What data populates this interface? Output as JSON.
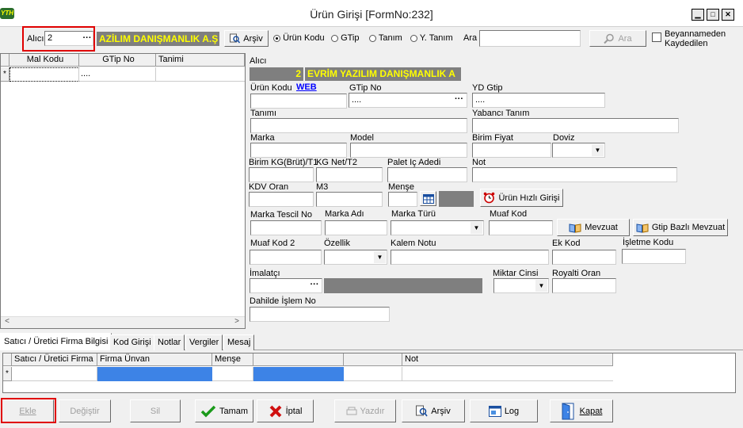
{
  "window": {
    "title": "Ürün Girişi [FormNo:232]",
    "app_icon_text": "YTH",
    "minimize": "▁",
    "maximize": "□",
    "close": "✕"
  },
  "toolbar": {
    "alici_label": "Alıcı",
    "alici_value": "2",
    "alici_lookup": "···",
    "alici_name": "AZİLIM DANIŞMANLIK A.Ş",
    "arsiv_label": "Arşiv",
    "radio_urun_kodu": "Ürün Kodu",
    "radio_gtip": "GTip",
    "radio_tanim": "Tanım",
    "radio_y_tanim": "Y. Tanım",
    "ara_label": "Ara",
    "ara_value": "",
    "ara_button": "Ara",
    "beyanname_line1": "Beyannameden",
    "beyanname_line2": "Kaydedilen"
  },
  "left_grid": {
    "headers": [
      "Mal Kodu",
      "GTip No",
      "Tanimi"
    ],
    "new_row_marker": "*",
    "new_row_gtip": "....",
    "scroll_left": "<",
    "scroll_right": ">"
  },
  "form": {
    "alici_label": "Alıcı",
    "alici_number": "2",
    "alici_name": "EVRİM YAZILIM DANIŞMANLIK A",
    "urun_kodu_label": "Ürün Kodu",
    "web_link": "WEB",
    "gtip_no_label": "GTip No",
    "gtip_no_value": "....",
    "gtip_lookup": "···",
    "yd_gtip_label": "YD Gtip",
    "yd_gtip_value": "....",
    "tanimi_label": "Tanımı",
    "yabanci_tanim_label": "Yabancı Tanım",
    "marka_label": "Marka",
    "model_label": "Model",
    "birim_fiyat_label": "Birim Fiyat",
    "doviz_label": "Doviz",
    "birim_kg_label": "Birim KG(Brüt)/T1",
    "kg_net_label": "KG Net/T2",
    "palet_label": "Palet Iç Adedi",
    "not_label": "Not",
    "kdv_label": "KDV Oran",
    "m3_label": "M3",
    "mense_label": "Menşe",
    "urun_hizli_button": "Ürün Hızlı Girişi",
    "marka_tescil_label": "Marka Tescil No",
    "marka_adi_label": "Marka Adı",
    "marka_turu_label": "Marka Türü",
    "muaf_kod_label": "Muaf Kod",
    "mevzuat_button": "Mevzuat",
    "gtip_mevzuat_button": "Gtip Bazlı Mevzuat",
    "muaf_kod2_label": "Muaf Kod 2",
    "ozellik_label": "Özellik",
    "kalem_notu_label": "Kalem Notu",
    "ek_kod_label": "Ek Kod",
    "isletme_kodu_label": "İşletme Kodu",
    "imalatci_label": "İmalatçı",
    "imalatci_lookup": "···",
    "miktar_cinsi_label": "Miktar Cinsi",
    "royalti_label": "Royalti Oran",
    "dahilde_label": "Dahilde İşlem No"
  },
  "tabs": [
    "Satıcı / Üretici Firma Bilgisi",
    "Kod Girişi",
    "Notlar",
    "Vergiler",
    "Mesaj"
  ],
  "bottom_grid": {
    "headers": [
      "Satıcı / Üretici Firma",
      "Firma Ünvan",
      "Menşe",
      "",
      "",
      "Not"
    ],
    "new_row_marker": "*"
  },
  "buttons": {
    "ekle": "Ekle",
    "degistir": "Değiştir",
    "sil": "Sil",
    "tamam": "Tamam",
    "iptal": "İptal",
    "yazdir": "Yazdır",
    "arsiv": "Arşiv",
    "log": "Log",
    "kapat": "Kapat"
  },
  "colors": {
    "highlight_red": "#e00000",
    "selection_blue": "#3d83e6",
    "name_yellow": "#ffff00"
  }
}
